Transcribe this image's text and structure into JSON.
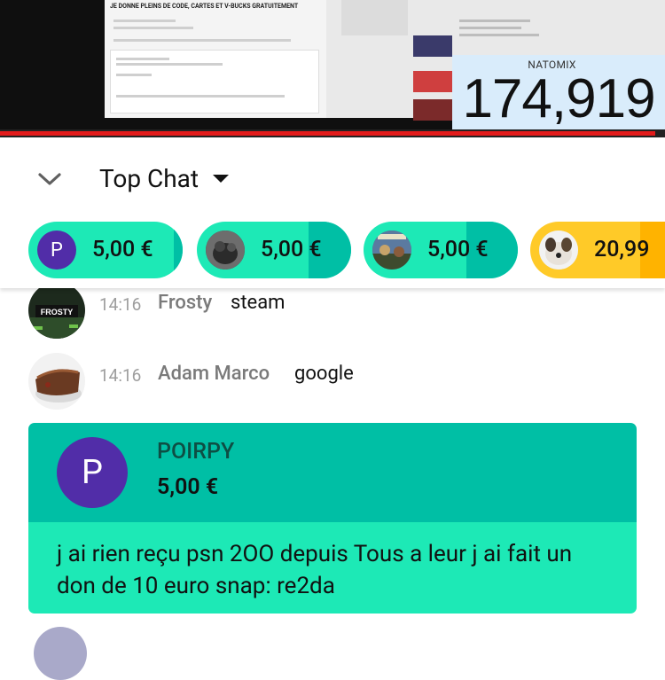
{
  "video": {
    "overlay_header": "JE DONNE PLEINS DE CODE, CARTES ET V-BUCKS GRATUITEMENT",
    "counter_name": "NATOMIX",
    "counter_value": "174,919",
    "progress": 0.985,
    "progress_color": "#e21b1b"
  },
  "chat_header": {
    "mode_label": "Top Chat",
    "collapse_icon": "chevron-down-icon",
    "dropdown_icon": "caret-down-icon"
  },
  "tickers": [
    {
      "amount": "5,00 €",
      "avatar_letter": "P",
      "avatar_color": "#512da8",
      "color": "#1de9b6",
      "band_color": "#00bfa5"
    },
    {
      "amount": "5,00 €",
      "avatar_letter": "",
      "avatar_color": "#3a3a3a",
      "color": "#1de9b6",
      "band_color": "#00bfa5"
    },
    {
      "amount": "5,00 €",
      "avatar_letter": "",
      "avatar_color": "#4a5f7a",
      "color": "#1de9b6",
      "band_color": "#00bfa5"
    },
    {
      "amount": "20,99",
      "avatar_letter": "",
      "avatar_color": "#e0d6c8",
      "color": "#ffca28",
      "band_color": "#ffb300"
    }
  ],
  "messages": [
    {
      "time": "14:16",
      "author": "Frosty",
      "text": "steam",
      "avatar_text": "FROSTY"
    },
    {
      "time": "14:16",
      "author": "Adam Marco",
      "text": "google"
    }
  ],
  "superchat": {
    "avatar_letter": "P",
    "name": "POIRPY",
    "amount": "5,00 €",
    "message": "j ai rien reçu psn 2OO depuis Tous a leur j ai fait un don de 10 euro snap: re2da",
    "header_color": "#00bfa5",
    "body_color": "#1de9b6"
  }
}
